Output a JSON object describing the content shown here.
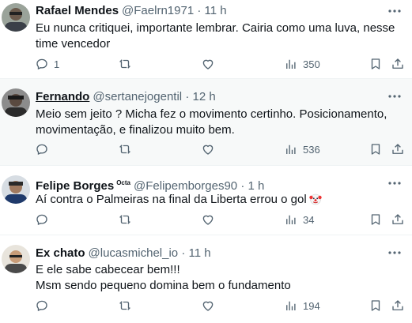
{
  "tweets": [
    {
      "name": "Rafael Mendes",
      "handle": "@Faelrn1971",
      "separator": "·",
      "time": "11 h",
      "text": "Eu nunca critiquei, importante lembrar. Cairia como uma luva, nesse time vencedor",
      "replies": "1",
      "retweets": "",
      "likes": "",
      "views": "350",
      "icons": [
        "reply-icon",
        "retweet-icon",
        "like-icon",
        "views-icon",
        "bookmark-icon",
        "share-icon",
        "more-icon"
      ]
    },
    {
      "name": "Fernando",
      "handle": "@sertanejogentil",
      "separator": "·",
      "time": "12 h",
      "text": "Meio sem jeito ? Micha fez o movimento certinho. Posicionamento, movimentação, e finalizou muito bem.",
      "replies": "",
      "retweets": "",
      "likes": "",
      "views": "536"
    },
    {
      "name": "Felipe Borges",
      "badge": "Octa",
      "handle": "@Felipemborges90",
      "separator": "·",
      "time": "1 h",
      "text": "Aí contra o Palmeiras na final da Liberta errou o gol",
      "emoji": "clown-face-emoji",
      "replies": "",
      "retweets": "",
      "likes": "",
      "views": "34"
    },
    {
      "name": "Ex chato",
      "handle": "@lucasmichel_io",
      "separator": "·",
      "time": "11 h",
      "text_line1": "E ele sabe cabecear bem!!!",
      "text_line2": "Msm sendo pequeno domina bem o fundamento",
      "replies": "",
      "retweets": "",
      "likes": "",
      "views": "194"
    }
  ],
  "colors": {
    "text": "#0f1419",
    "secondary": "#536471",
    "hover_background": "#f7f9f9",
    "divider": "#eff3f4"
  }
}
